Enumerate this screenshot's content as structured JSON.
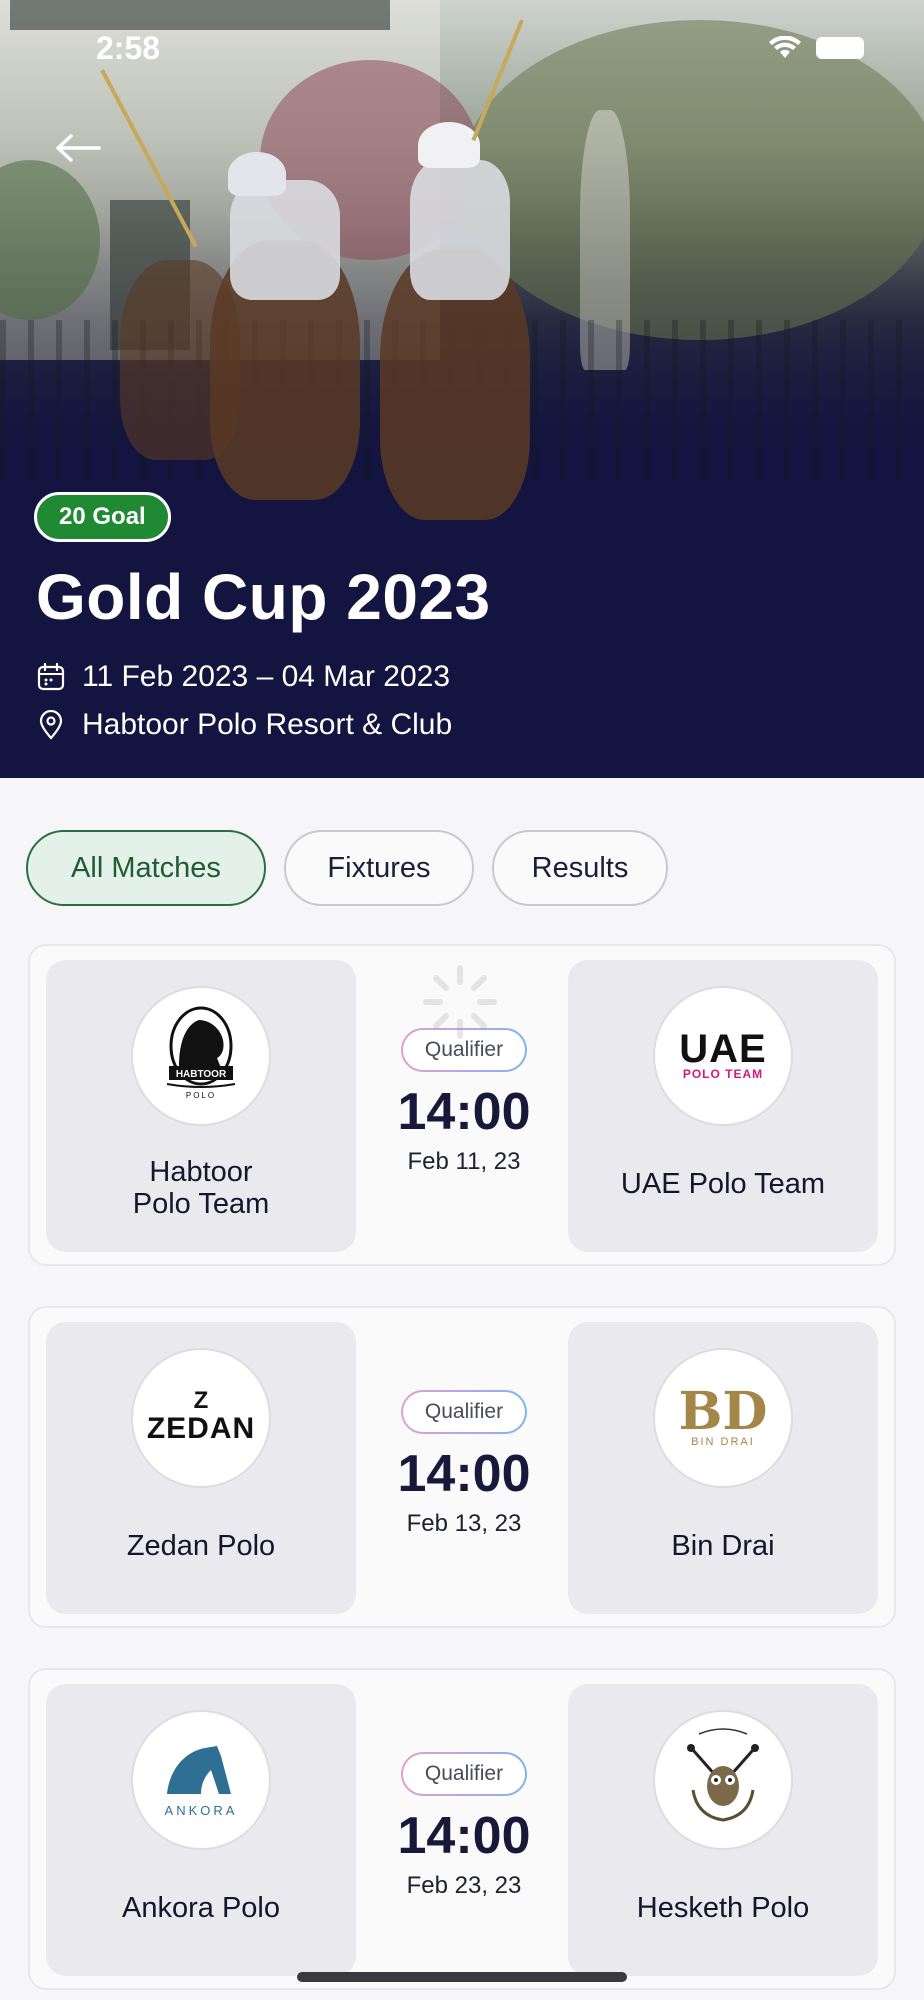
{
  "status_bar": {
    "time": "2:58"
  },
  "event": {
    "badge": "20 Goal",
    "title": "Gold Cup 2023",
    "date_range": "11 Feb 2023 – 04 Mar 2023",
    "venue": "Habtoor Polo Resort & Club"
  },
  "tabs": [
    {
      "label": "All Matches",
      "active": true
    },
    {
      "label": "Fixtures",
      "active": false
    },
    {
      "label": "Results",
      "active": false
    }
  ],
  "matches": [
    {
      "home": {
        "name": "Habtoor Polo Team",
        "name_lines": [
          "Habtoor",
          "Polo Team"
        ],
        "logo_text": "HABTOOR",
        "logo_sub": "POLO"
      },
      "away": {
        "name": "UAE Polo Team",
        "logo_text": "UAE",
        "logo_sub": "POLO TEAM"
      },
      "stage": "Qualifier",
      "time": "14:00",
      "date": "Feb 11, 23"
    },
    {
      "home": {
        "name": "Zedan Polo",
        "logo_mark": "Z",
        "logo_text": "ZEDAN"
      },
      "away": {
        "name": "Bin Drai",
        "logo_mark": "BD",
        "logo_text": "BIN DRAI"
      },
      "stage": "Qualifier",
      "time": "14:00",
      "date": "Feb 13, 23"
    },
    {
      "home": {
        "name": "Ankora Polo",
        "logo_text": "ANKORA"
      },
      "away": {
        "name": "Hesketh Polo"
      },
      "stage": "Qualifier",
      "time": "14:00",
      "date": "Feb 23, 23"
    }
  ],
  "colors": {
    "hero_navy": "#13143f",
    "badge_green": "#1f8a33",
    "tab_active_bg": "#e3f1e8",
    "tab_active_border": "#2c6e44",
    "card_bg": "#fafafb",
    "team_box_bg": "#e9e9ee"
  },
  "icons": {
    "back": "arrow-left-icon",
    "calendar": "calendar-icon",
    "location": "map-pin-icon",
    "wifi": "wifi-icon",
    "battery": "battery-icon"
  }
}
